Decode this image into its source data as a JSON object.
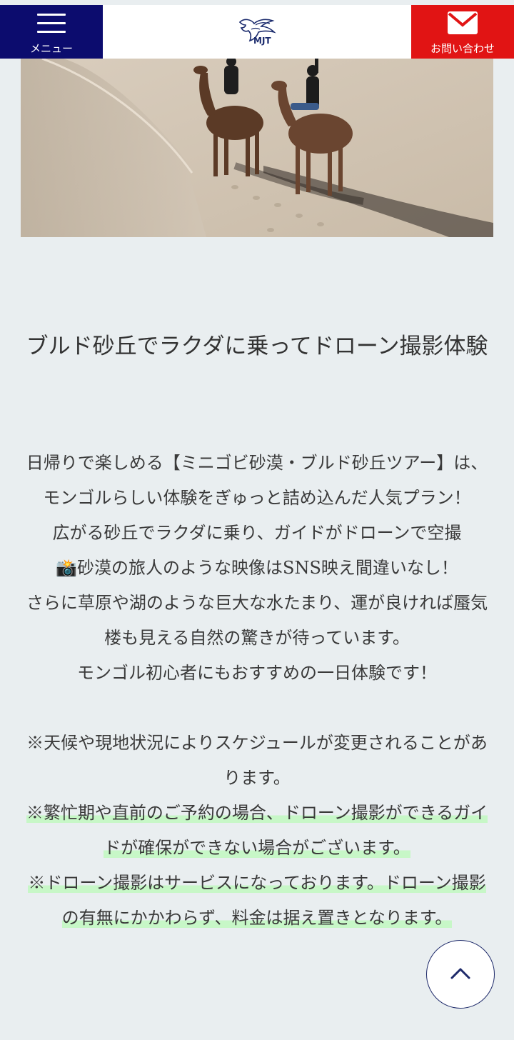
{
  "header": {
    "menu_label": "メニュー",
    "logo_text": "MJT",
    "contact_label": "お問い合わせ",
    "menu_color": "#0c0c6e",
    "contact_color": "#e11414"
  },
  "hero": {
    "image": "camels-on-sand-dune-photo"
  },
  "article": {
    "title": "ブルド砂丘でラクダに乗ってドローン撮影体験",
    "intro": [
      "日帰りで楽しめる【ミニゴビ砂漠・ブルド砂丘ツアー】は、モンゴルらしい体験をぎゅっと詰め込んだ人気プラン！",
      "広がる砂丘でラクダに乗り、ガイドがドローンで空撮",
      "砂漠の旅人のような映像はSNS映え間違いなし！",
      "さらに草原や湖のような巨大な水たまり、運が良ければ蜃気楼も見える自然の驚きが待っています。",
      "モンゴル初心者にもおすすめの一日体験です！"
    ],
    "camera_emoji": "📸",
    "notes": [
      "※天候や現地状況によりスケジュールが変更されることがあります。",
      "※繁忙期や直前のご予約の場合、ドローン撮影ができるガイドが確保ができない場合がございます。",
      "※ドローン撮影はサービスになっております。ドローン撮影の有無にかかわらず、料金は据え置きとなります。"
    ]
  },
  "back_to_top": {
    "icon": "chevron-up-icon"
  }
}
